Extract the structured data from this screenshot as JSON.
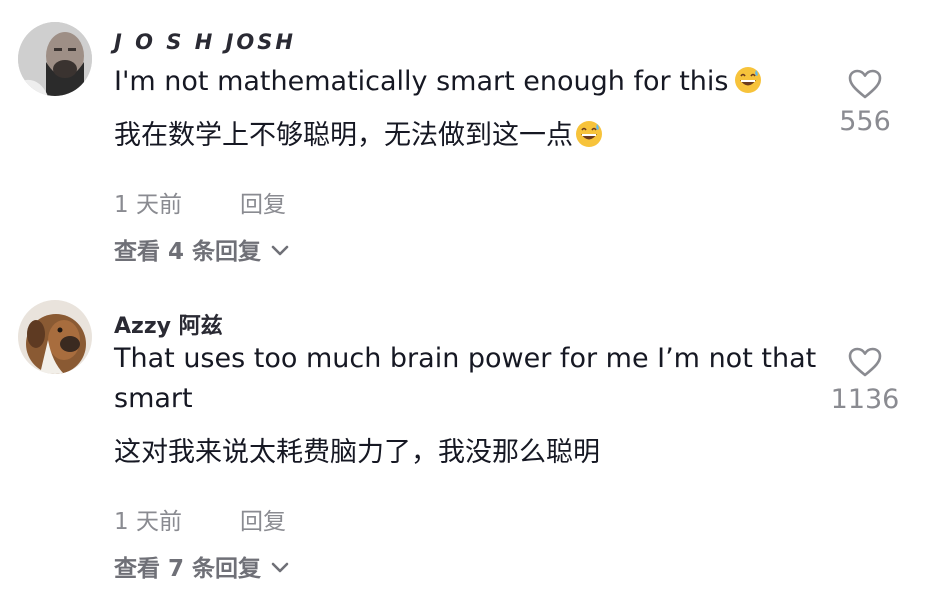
{
  "comments": [
    {
      "username": "J O S H JOSH",
      "text": "I'm not mathematically smart enough for this",
      "translation": "我在数学上不够聪明，无法做到这一点",
      "time": "1 天前",
      "reply_label": "回复",
      "view_replies": "查看 4 条回复",
      "likes": "556",
      "emoji": "grinning-sweat-emoji"
    },
    {
      "username": "Azzy 阿兹",
      "text": "That uses too much brain power for me I’m not that smart",
      "translation": "这对我来说太耗费脑力了，我没那么聪明",
      "time": "1 天前",
      "reply_label": "回复",
      "view_replies": "查看 7 条回复",
      "likes": "1136"
    }
  ],
  "icons": {
    "like": "heart-outline-icon",
    "expand": "chevron-down-icon"
  },
  "colors": {
    "text": "#161823",
    "secondary": "#8a8b91",
    "background": "#ffffff"
  }
}
